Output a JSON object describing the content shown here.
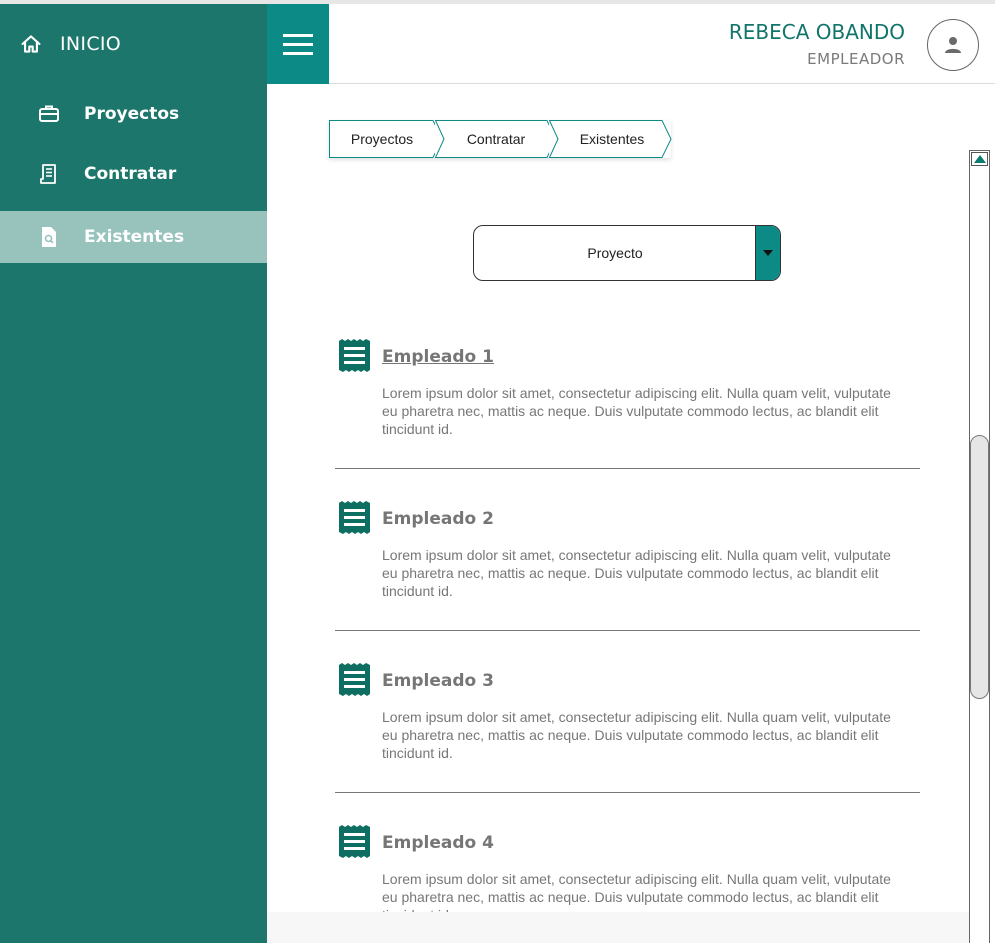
{
  "sidebar": {
    "home_label": "INICIO",
    "items": [
      {
        "label": "Proyectos",
        "icon": "briefcase-icon"
      },
      {
        "label": "Contratar",
        "icon": "receipt-icon"
      },
      {
        "label": "Existentes",
        "icon": "search-document-icon",
        "active": true
      }
    ]
  },
  "header": {
    "user_name": "REBECA OBANDO",
    "user_role": "EMPLEADOR",
    "avatar_icon": "user-icon",
    "menu_icon": "hamburger-icon"
  },
  "breadcrumb": [
    "Proyectos",
    "Contratar",
    "Existentes"
  ],
  "filter": {
    "selected": "Proyecto"
  },
  "employees": [
    {
      "name": "Empleado 1",
      "description": "Lorem ipsum dolor sit amet, consectetur adipiscing elit. Nulla quam velit, vulputate eu pharetra nec, mattis ac neque. Duis vulputate commodo lectus, ac blandit elit tincidunt id."
    },
    {
      "name": "Empleado 2",
      "description": "Lorem ipsum dolor sit amet, consectetur adipiscing elit. Nulla quam velit, vulputate eu pharetra nec, mattis ac neque. Duis vulputate commodo lectus, ac blandit elit tincidunt id."
    },
    {
      "name": "Empleado 3",
      "description": "Lorem ipsum dolor sit amet, consectetur adipiscing elit. Nulla quam velit, vulputate eu pharetra nec, mattis ac neque. Duis vulputate commodo lectus, ac blandit elit tincidunt id."
    },
    {
      "name": "Empleado 4",
      "description": "Lorem ipsum dolor sit amet, consectetur adipiscing elit. Nulla quam velit, vulputate eu pharetra nec, mattis ac neque. Duis vulputate commodo lectus, ac blandit elit tincidunt id."
    }
  ],
  "colors": {
    "sidebar": "#1d766b",
    "sidebar_active": "#98c3bd",
    "accent": "#0b8a86",
    "name_text": "#11756b"
  }
}
